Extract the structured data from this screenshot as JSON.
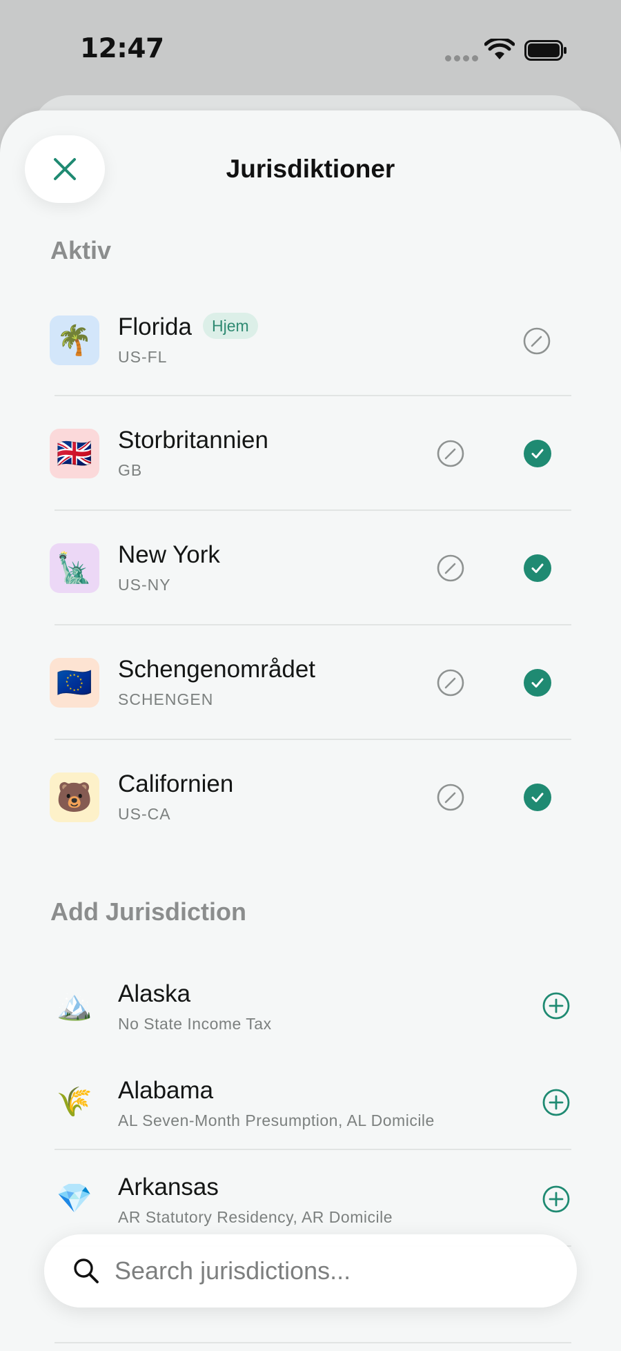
{
  "status_bar": {
    "time": "12:47"
  },
  "header": {
    "title": "Jurisdiktioner"
  },
  "sections": {
    "active_title": "Aktiv",
    "add_title": "Add Jurisdiction"
  },
  "active": [
    {
      "name": "Florida",
      "code": "US-FL",
      "icon": "🌴",
      "icon_bg": "#d3e6fa",
      "badge": "Hjem",
      "checked": false
    },
    {
      "name": "Storbritannien",
      "code": "GB",
      "icon": "🇬🇧",
      "icon_bg": "#fbd9da",
      "badge": "",
      "checked": true
    },
    {
      "name": "New York",
      "code": "US-NY",
      "icon": "🗽",
      "icon_bg": "#ecd8f6",
      "badge": "",
      "checked": true
    },
    {
      "name": "Schengenområdet",
      "code": "SCHENGEN",
      "icon": "🇪🇺",
      "icon_bg": "#fde3d2",
      "badge": "",
      "checked": true
    },
    {
      "name": "Californien",
      "code": "US-CA",
      "icon": "🐻",
      "icon_bg": "#fdf1c9",
      "badge": "",
      "checked": true
    }
  ],
  "add": [
    {
      "name": "Alaska",
      "subtitle": "No State Income Tax",
      "icon": "🏔️"
    },
    {
      "name": "Alabama",
      "subtitle": "AL Seven-Month Presumption, AL Domicile",
      "icon": "🌾"
    },
    {
      "name": "Arkansas",
      "subtitle": "AR Statutory Residency, AR Domicile",
      "icon": "💎"
    }
  ],
  "search": {
    "placeholder": "Search jurisdictions..."
  },
  "colors": {
    "accent": "#1f8a72",
    "sheet_bg": "#f5f7f7",
    "muted_text": "#7c807f"
  }
}
